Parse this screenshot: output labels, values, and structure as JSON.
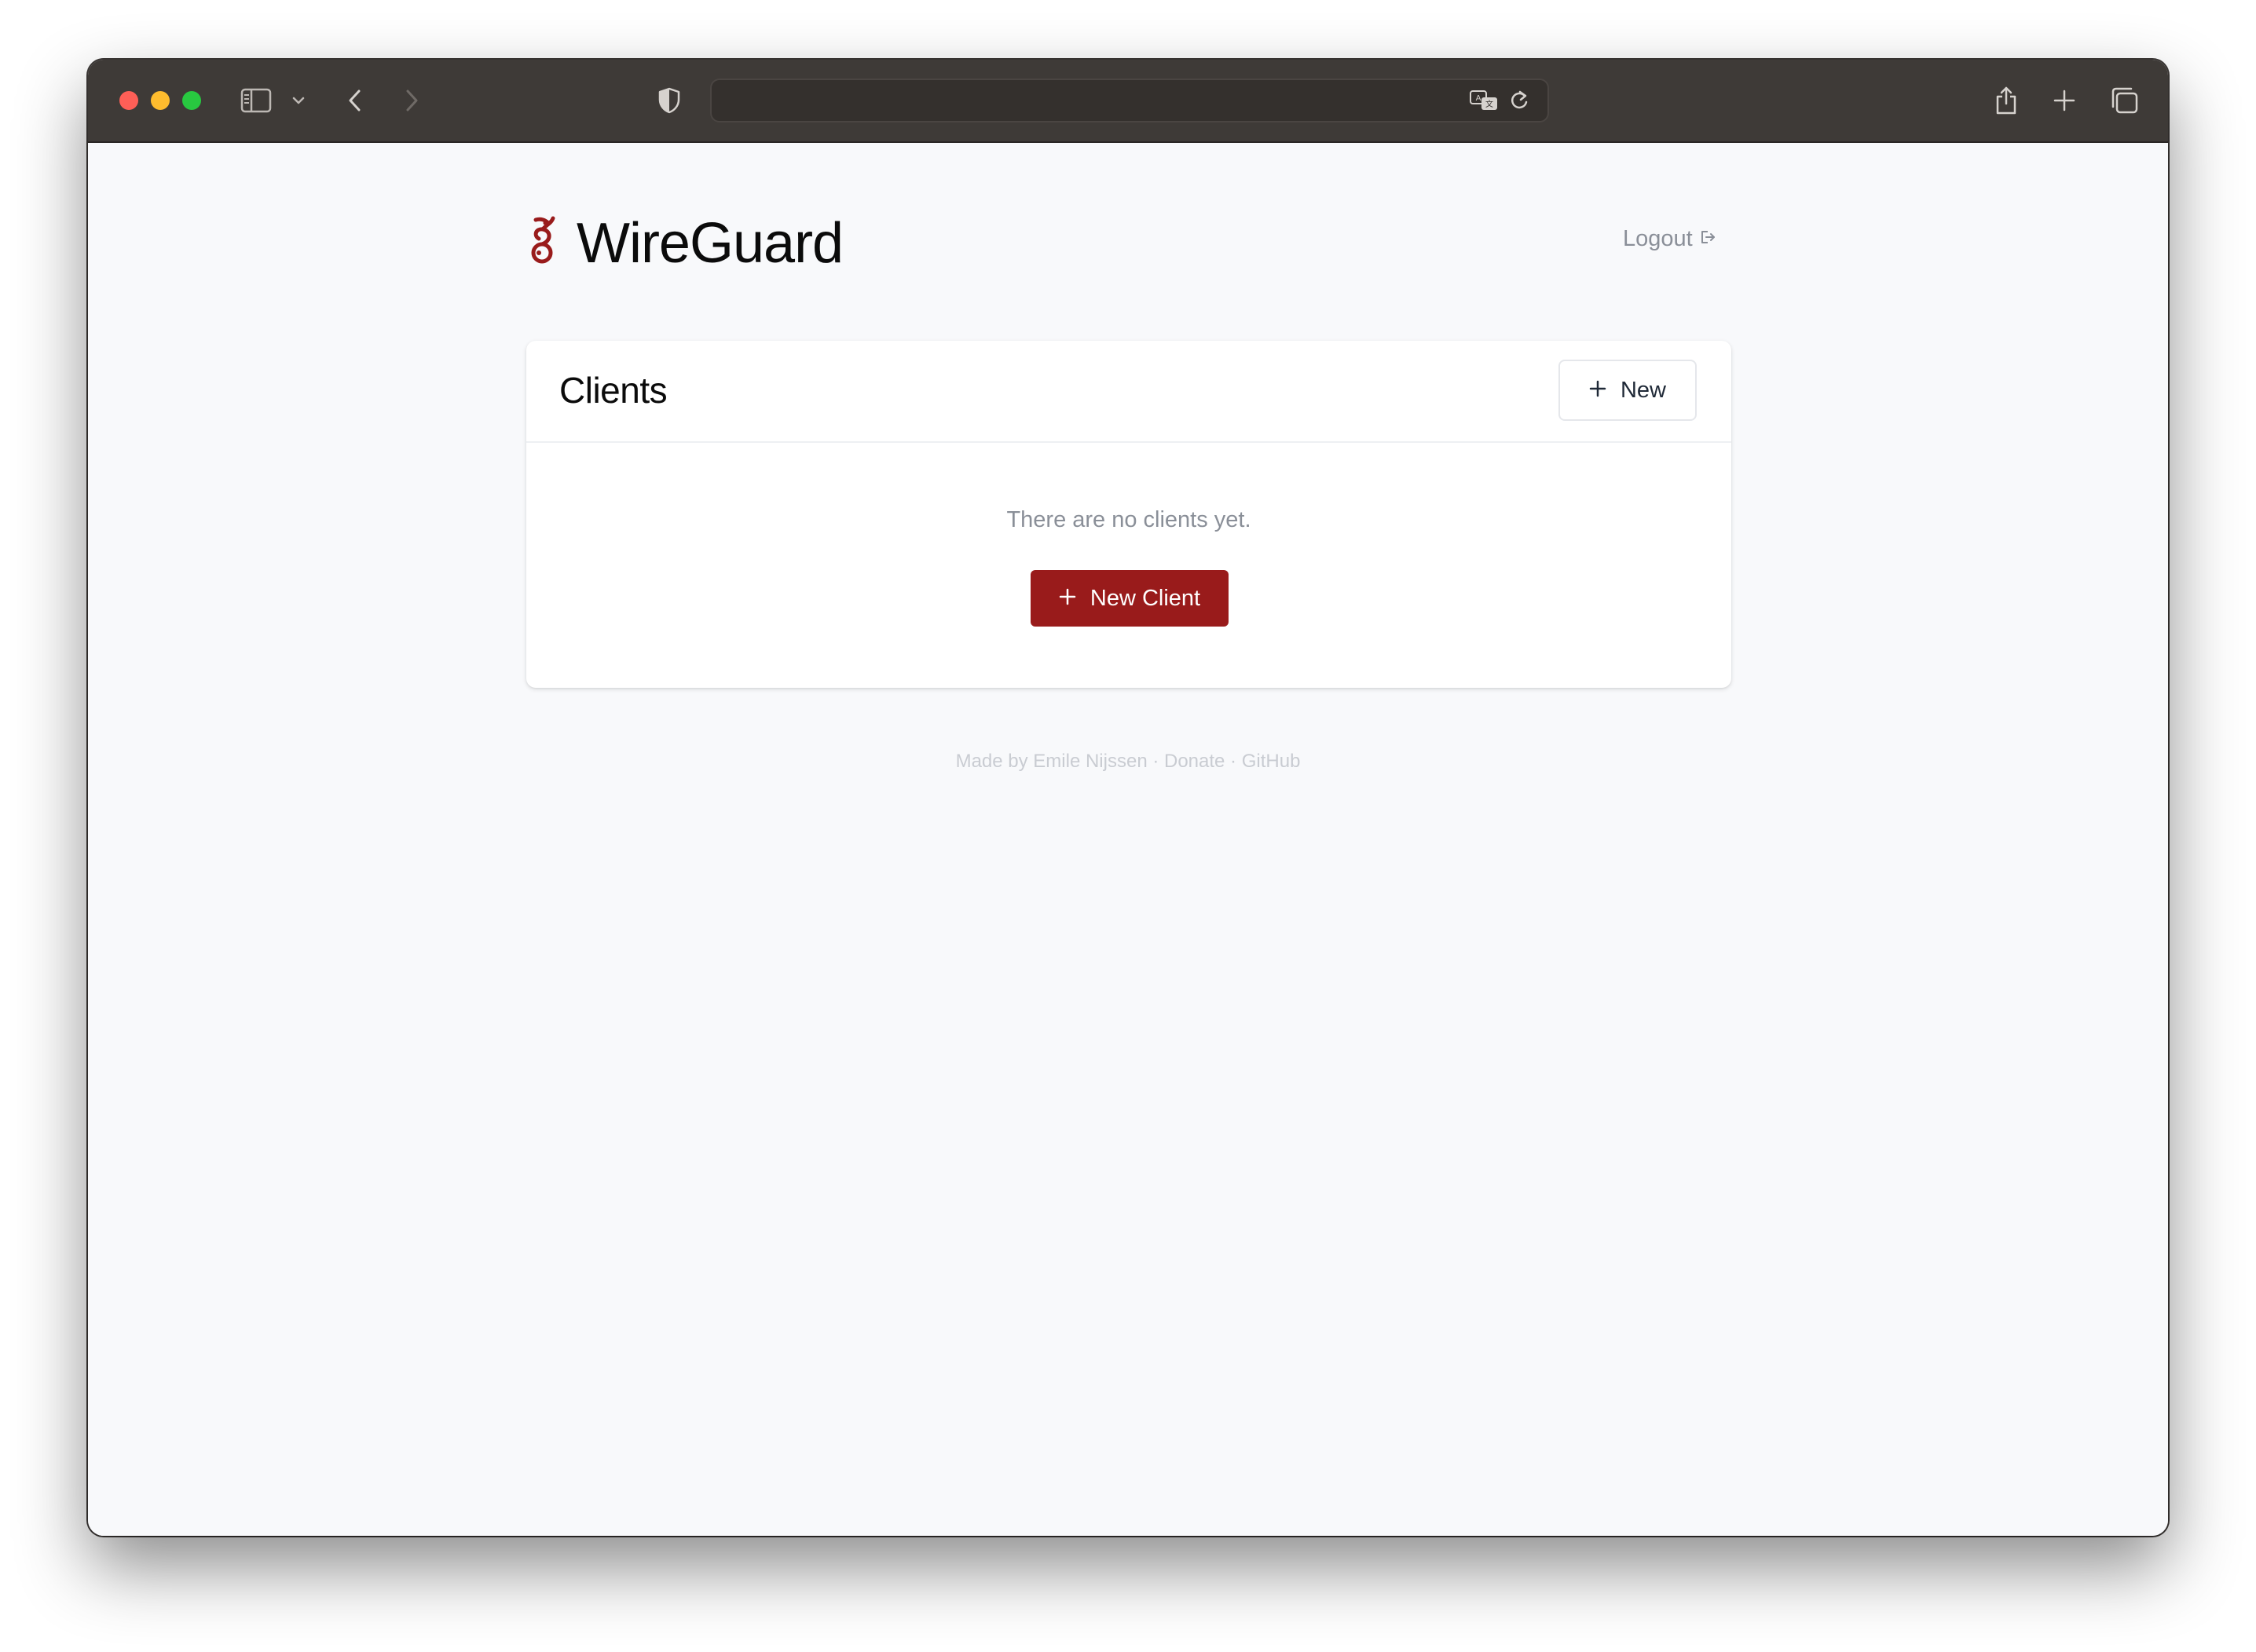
{
  "browser": {
    "address_value": "",
    "icons": {
      "sidebar": "sidebar-icon",
      "chevron": "chevron-down-icon",
      "back": "back-arrow-icon",
      "forward": "forward-arrow-icon",
      "shield": "shield-icon",
      "translate": "translate-icon",
      "reload": "reload-icon",
      "share": "share-icon",
      "new_tab": "plus-icon",
      "tabs": "tab-overview-icon"
    }
  },
  "header": {
    "brand_title": "WireGuard",
    "logout_label": "Logout"
  },
  "clients_card": {
    "title": "Clients",
    "new_button_label": "New",
    "empty_message": "There are no clients yet.",
    "new_client_button_label": "New Client"
  },
  "footer": {
    "made_by": "Made by Emile Nijssen",
    "separator": " · ",
    "donate": "Donate",
    "github": "GitHub"
  },
  "colors": {
    "brand_red": "#991b1b",
    "page_bg": "#f8f9fb",
    "toolbar_bg": "#3e3a37",
    "muted_text": "#8a8f98"
  }
}
